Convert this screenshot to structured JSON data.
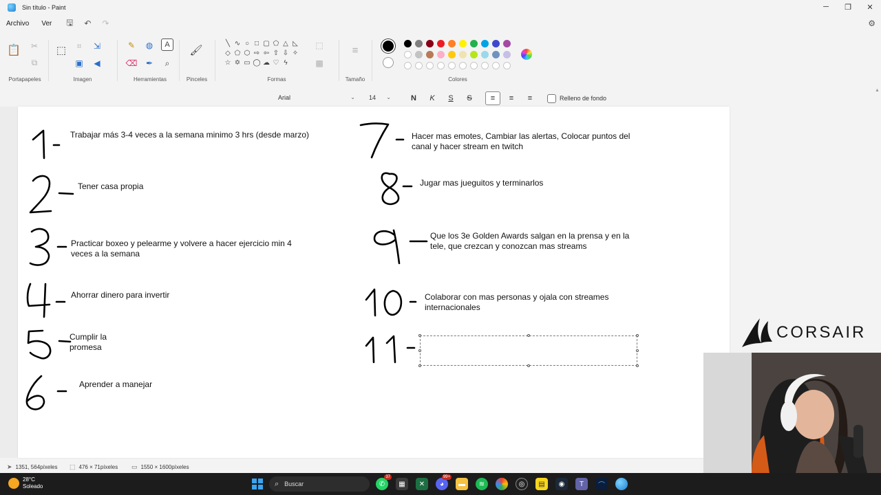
{
  "window": {
    "title": "Sin título - Paint"
  },
  "menu": {
    "archivo": "Archivo",
    "ver": "Ver"
  },
  "ribbon": {
    "groups": {
      "clipboard": "Portapapeles",
      "image": "Imagen",
      "tools": "Herramientas",
      "brushes": "Pinceles",
      "shapes": "Formas",
      "size": "Tamaño",
      "colors": "Colores"
    },
    "colors": {
      "primary": "#000000",
      "secondary": "#ffffff",
      "palette_row1": [
        "#000000",
        "#7f7f7f",
        "#880015",
        "#ed1c24",
        "#ff7f27",
        "#fff200",
        "#22b14c",
        "#00a2e8",
        "#3f48cc",
        "#a349a4"
      ],
      "palette_row2": [
        "#ffffff",
        "#c3c3c3",
        "#b97a57",
        "#ffaec9",
        "#ffc90e",
        "#efe4b0",
        "#b5e61d",
        "#99d9ea",
        "#7092be",
        "#c8bfe7"
      ]
    }
  },
  "text_toolbar": {
    "font": "Arial",
    "size": "14",
    "bold": "N",
    "italic": "K",
    "underline": "S",
    "strike": "S",
    "background_fill": "Relleno de fondo"
  },
  "canvas": {
    "notes": [
      {
        "number": "1",
        "text": "Trabajar más 3-4 veces a la semana minimo 3 hrs (desde marzo)"
      },
      {
        "number": "2",
        "text": "Tener casa propia"
      },
      {
        "number": "3",
        "text": "Practicar boxeo y pelearme y volvere a hacer ejercicio min 4 veces a la semana"
      },
      {
        "number": "4",
        "text": "Ahorrar dinero para invertir"
      },
      {
        "number": "5",
        "text": "Cumplir la promesa"
      },
      {
        "number": "6",
        "text": "Aprender a manejar"
      },
      {
        "number": "7",
        "text": "Hacer mas emotes, Cambiar las alertas, Colocar puntos del canal y hacer stream en twitch"
      },
      {
        "number": "8",
        "text": "Jugar mas jueguitos y terminarlos"
      },
      {
        "number": "9",
        "text": "Que los 3e Golden Awards salgan en la prensa y en la tele, que crezcan y conozcan mas streams"
      },
      {
        "number": "10",
        "text": "Colaborar con mas personas y ojala con streames internacionales"
      },
      {
        "number": "11",
        "text": ""
      }
    ]
  },
  "status": {
    "cursor": "1351, 564píxeles",
    "selection": "476 × 71píxeles",
    "canvas_size": "1550 × 1600píxeles"
  },
  "overlay": {
    "brand": "CORSAIR"
  },
  "taskbar": {
    "weather_temp": "28°C",
    "weather_desc": "Soleado",
    "search_placeholder": "Buscar",
    "whatsapp_badge": "37",
    "discord_badge": "99+"
  }
}
